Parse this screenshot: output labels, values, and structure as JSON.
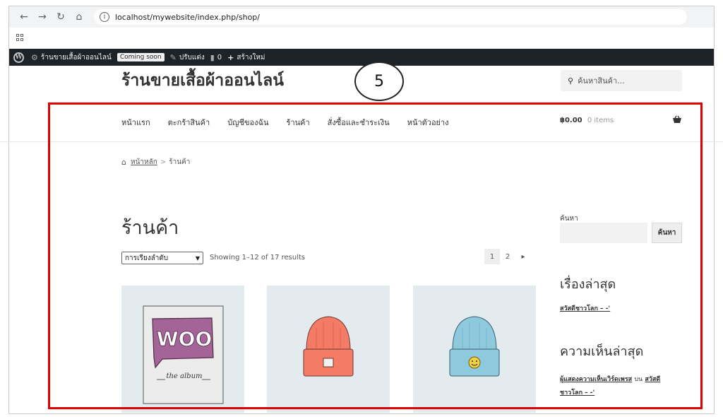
{
  "browser": {
    "url": "localhost/mywebsite/index.php/shop/",
    "icons": [
      "back-icon",
      "forward-icon",
      "reload-icon",
      "home-icon",
      "info-icon",
      "apps-grid-icon"
    ]
  },
  "admin_bar": {
    "site_name": "ร้านขายเสื้อผ้าออนไลน์",
    "coming_soon": "Coming soon",
    "customize": "ปรับแต่ง",
    "comments_count": "0",
    "new_label": "สร้างใหม่"
  },
  "header": {
    "site_title": "ร้านขายเสื้อผ้าออนไลน์",
    "search_placeholder": "ค้นหาสินค้า...",
    "step_number": "5"
  },
  "nav": {
    "items": [
      "หน้าแรก",
      "ตะกร้าสินค้า",
      "บัญชีของฉัน",
      "ร้านค้า",
      "สั่งซื้อและชำระเงิน",
      "หน้าตัวอย่าง"
    ],
    "cart_amount": "฿0.00",
    "cart_items": "0 items"
  },
  "breadcrumb": {
    "home": "หน้าหลัก",
    "separator": ">",
    "current": "ร้านค้า"
  },
  "shop": {
    "title": "ร้านค้า",
    "sort_label": "การเรียงลำดับ",
    "results": "Showing 1–12 of 17 results",
    "pages": [
      "1",
      "2"
    ],
    "next": "▸",
    "products": [
      {
        "image": "woo-album-image",
        "woo_text": "WOO",
        "album_text": "the  album"
      },
      {
        "image": "orange-beanie-image"
      },
      {
        "image": "blue-beanie-image"
      }
    ]
  },
  "sidebar": {
    "search_label": "ค้นหา",
    "search_button": "ค้นหา",
    "recent_posts_heading": "เรื่องล่าสุด",
    "recent_post": "สวัสดีชาวโลก – -'",
    "recent_comments_heading": "ความเห็นล่าสุด",
    "comment_author": "ผู้แสดงความเห็นเวิร์ดเพรส",
    "comment_on": "บน",
    "comment_post_1": "สวัสดี",
    "comment_post_2": "ชาวโลก – -'"
  },
  "colors": {
    "annotation": "#e00000",
    "admin_bar": "#1d2327",
    "product_bg": "#e3ebee",
    "beanie_orange": "#f47b66",
    "beanie_blue": "#8ec9de"
  }
}
